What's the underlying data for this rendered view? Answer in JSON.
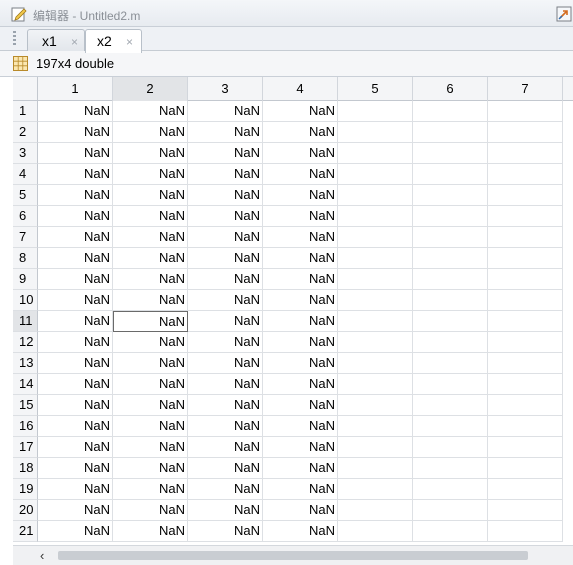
{
  "window": {
    "title": "编辑器 - Untitled2.m"
  },
  "tabs": [
    {
      "label": "x1",
      "close": "×",
      "active": false
    },
    {
      "label": "x2",
      "close": "×",
      "active": true
    }
  ],
  "variable_info": "197x4 double",
  "columns": [
    "1",
    "2",
    "3",
    "4",
    "5",
    "6",
    "7"
  ],
  "rows": [
    {
      "index": "1",
      "values": [
        "NaN",
        "NaN",
        "NaN",
        "NaN"
      ]
    },
    {
      "index": "2",
      "values": [
        "NaN",
        "NaN",
        "NaN",
        "NaN"
      ]
    },
    {
      "index": "3",
      "values": [
        "NaN",
        "NaN",
        "NaN",
        "NaN"
      ]
    },
    {
      "index": "4",
      "values": [
        "NaN",
        "NaN",
        "NaN",
        "NaN"
      ]
    },
    {
      "index": "5",
      "values": [
        "NaN",
        "NaN",
        "NaN",
        "NaN"
      ]
    },
    {
      "index": "6",
      "values": [
        "NaN",
        "NaN",
        "NaN",
        "NaN"
      ]
    },
    {
      "index": "7",
      "values": [
        "NaN",
        "NaN",
        "NaN",
        "NaN"
      ]
    },
    {
      "index": "8",
      "values": [
        "NaN",
        "NaN",
        "NaN",
        "NaN"
      ]
    },
    {
      "index": "9",
      "values": [
        "NaN",
        "NaN",
        "NaN",
        "NaN"
      ]
    },
    {
      "index": "10",
      "values": [
        "NaN",
        "NaN",
        "NaN",
        "NaN"
      ]
    },
    {
      "index": "11",
      "values": [
        "NaN",
        "NaN",
        "NaN",
        "NaN"
      ]
    },
    {
      "index": "12",
      "values": [
        "NaN",
        "NaN",
        "NaN",
        "NaN"
      ]
    },
    {
      "index": "13",
      "values": [
        "NaN",
        "NaN",
        "NaN",
        "NaN"
      ]
    },
    {
      "index": "14",
      "values": [
        "NaN",
        "NaN",
        "NaN",
        "NaN"
      ]
    },
    {
      "index": "15",
      "values": [
        "NaN",
        "NaN",
        "NaN",
        "NaN"
      ]
    },
    {
      "index": "16",
      "values": [
        "NaN",
        "NaN",
        "NaN",
        "NaN"
      ]
    },
    {
      "index": "17",
      "values": [
        "NaN",
        "NaN",
        "NaN",
        "NaN"
      ]
    },
    {
      "index": "18",
      "values": [
        "NaN",
        "NaN",
        "NaN",
        "NaN"
      ]
    },
    {
      "index": "19",
      "values": [
        "NaN",
        "NaN",
        "NaN",
        "NaN"
      ]
    },
    {
      "index": "20",
      "values": [
        "NaN",
        "NaN",
        "NaN",
        "NaN"
      ]
    },
    {
      "index": "21",
      "values": [
        "NaN",
        "NaN",
        "NaN",
        "NaN"
      ]
    }
  ],
  "selection": {
    "row": "11",
    "column": "2"
  },
  "scrollbar": {
    "left_arrow": "‹"
  },
  "icons": {
    "title": "edit-icon",
    "dock": "undock-icon",
    "variable": "grid-icon"
  },
  "colors": {
    "header_bg": "#f4f5f7",
    "selected_header_bg": "#e2e4e7",
    "grid_line": "#dde0e4"
  }
}
